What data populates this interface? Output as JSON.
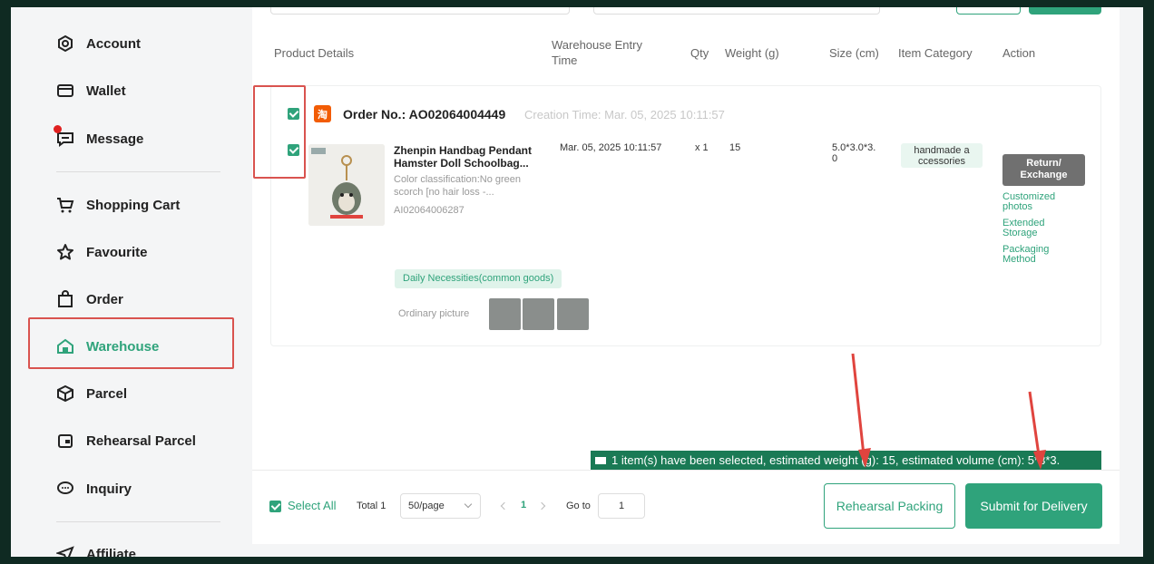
{
  "sidebar": {
    "items": [
      {
        "label": "Account",
        "icon": "account-icon"
      },
      {
        "label": "Wallet",
        "icon": "wallet-icon"
      },
      {
        "label": "Message",
        "icon": "message-icon"
      },
      {
        "label": "Shopping Cart",
        "icon": "cart-icon"
      },
      {
        "label": "Favourite",
        "icon": "star-icon"
      },
      {
        "label": "Order",
        "icon": "bag-icon"
      },
      {
        "label": "Warehouse",
        "icon": "warehouse-icon"
      },
      {
        "label": "Parcel",
        "icon": "box-icon"
      },
      {
        "label": "Rehearsal Parcel",
        "icon": "rehearsal-icon"
      },
      {
        "label": "Inquiry",
        "icon": "chat-icon"
      },
      {
        "label": "Affiliate",
        "icon": "send-icon"
      }
    ]
  },
  "table": {
    "headers": {
      "product": "Product Details",
      "entry_line1": "Warehouse Entry",
      "entry_line2": "Time",
      "qty": "Qty",
      "weight": "Weight (g)",
      "size": "Size (cm)",
      "category": "Item Category",
      "action": "Action"
    }
  },
  "order": {
    "number": "Order No.: AO02064004449",
    "creation": "Creation Time: Mar. 05, 2025 10:11:57",
    "item": {
      "title_line1": "Zhenpin Handbag Pendant",
      "title_line2": "Hamster Doll Schoolbag...",
      "color_line1": "Color classification:No green",
      "color_line2": "scorch [no hair loss -...",
      "item_id": "AI02064006287",
      "entry_time": "Mar. 05, 2025 10:11:57",
      "qty": "x 1",
      "weight": "15",
      "size_line1": "5.0*3.0*3.",
      "size_line2": "0",
      "category_line1": "handmade a",
      "category_line2": "ccessories",
      "return_line1": "Return/",
      "return_line2": "Exchange",
      "links": [
        {
          "line1": "Customized",
          "line2": "photos"
        },
        {
          "line1": "Extended",
          "line2": "Storage"
        },
        {
          "line1": "Packaging",
          "line2": "Method"
        }
      ],
      "tag": "Daily Necessities(common goods)",
      "picture_label": "Ordinary picture",
      "platform_badge": "淘"
    }
  },
  "selection_banner": "1 item(s) have been selected, estimated weight (g): 15, estimated volume (cm): 5*3*3.",
  "footer": {
    "select_all": "Select All",
    "total": "Total 1",
    "page_size": "50/page",
    "current_page": "1",
    "goto_label": "Go to",
    "goto_value": "1",
    "rehearsal_button": "Rehearsal Packing",
    "submit_button": "Submit for Delivery"
  },
  "colors": {
    "accent": "#2fa37b",
    "highlight": "#d9534f",
    "arrow": "#e0443e",
    "banner": "#1a7a55"
  }
}
